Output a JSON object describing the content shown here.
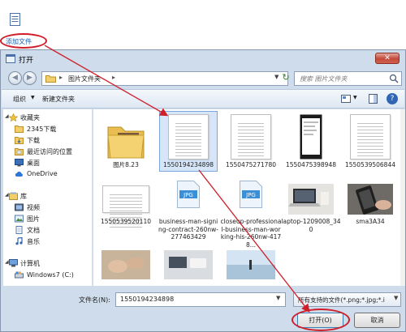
{
  "toolbar_top": {
    "add_file_label": "添加文件"
  },
  "dialog": {
    "title": "打开",
    "close_label": "✕",
    "address": {
      "path": "图片文件夹"
    },
    "search": {
      "placeholder": "搜索 图片文件夹"
    },
    "toolbar": {
      "organize": "组织",
      "new_folder": "新建文件夹"
    },
    "sidebar": {
      "favorites_header": "收藏夹",
      "favorites": [
        "2345下载",
        "下载",
        "最近访问的位置",
        "桌面",
        "OneDrive"
      ],
      "libraries_header": "库",
      "libraries": [
        "视频",
        "图片",
        "文档",
        "音乐"
      ],
      "computer_header": "计算机",
      "drives": [
        "Windows7 (C:)"
      ]
    },
    "files": [
      {
        "name": "图片8.23",
        "kind": "folder"
      },
      {
        "name": "1550194234898",
        "kind": "document",
        "selected": true
      },
      {
        "name": "1550475271780",
        "kind": "document"
      },
      {
        "name": "1550475398948",
        "kind": "phone"
      },
      {
        "name": "1550539506844",
        "kind": "document"
      },
      {
        "name": "1550539520110",
        "kind": "document-wide"
      },
      {
        "name": "business-man-signing-contract-260nw-277463429",
        "kind": "jpg"
      },
      {
        "name": "closeup-professional-business-man-working-his-260nw-4178...",
        "kind": "jpg"
      },
      {
        "name": "laptop-1209008_340",
        "kind": "photo-laptop"
      },
      {
        "name": "sma3A34",
        "kind": "photo-phone"
      },
      {
        "name": "",
        "kind": "photo-hands"
      },
      {
        "name": "",
        "kind": "photo-desk"
      },
      {
        "name": "",
        "kind": "photo-beach"
      }
    ],
    "filename_label": "文件名(N):",
    "filename_value": "1550194234898",
    "filetype_value": "所有支持的文件(*.png;*.jpg;*.i",
    "open_button": "打开(O)",
    "cancel_button": "取消"
  },
  "colors": {
    "annotation": "#cf1e2a",
    "accent": "#1a5fb4"
  }
}
